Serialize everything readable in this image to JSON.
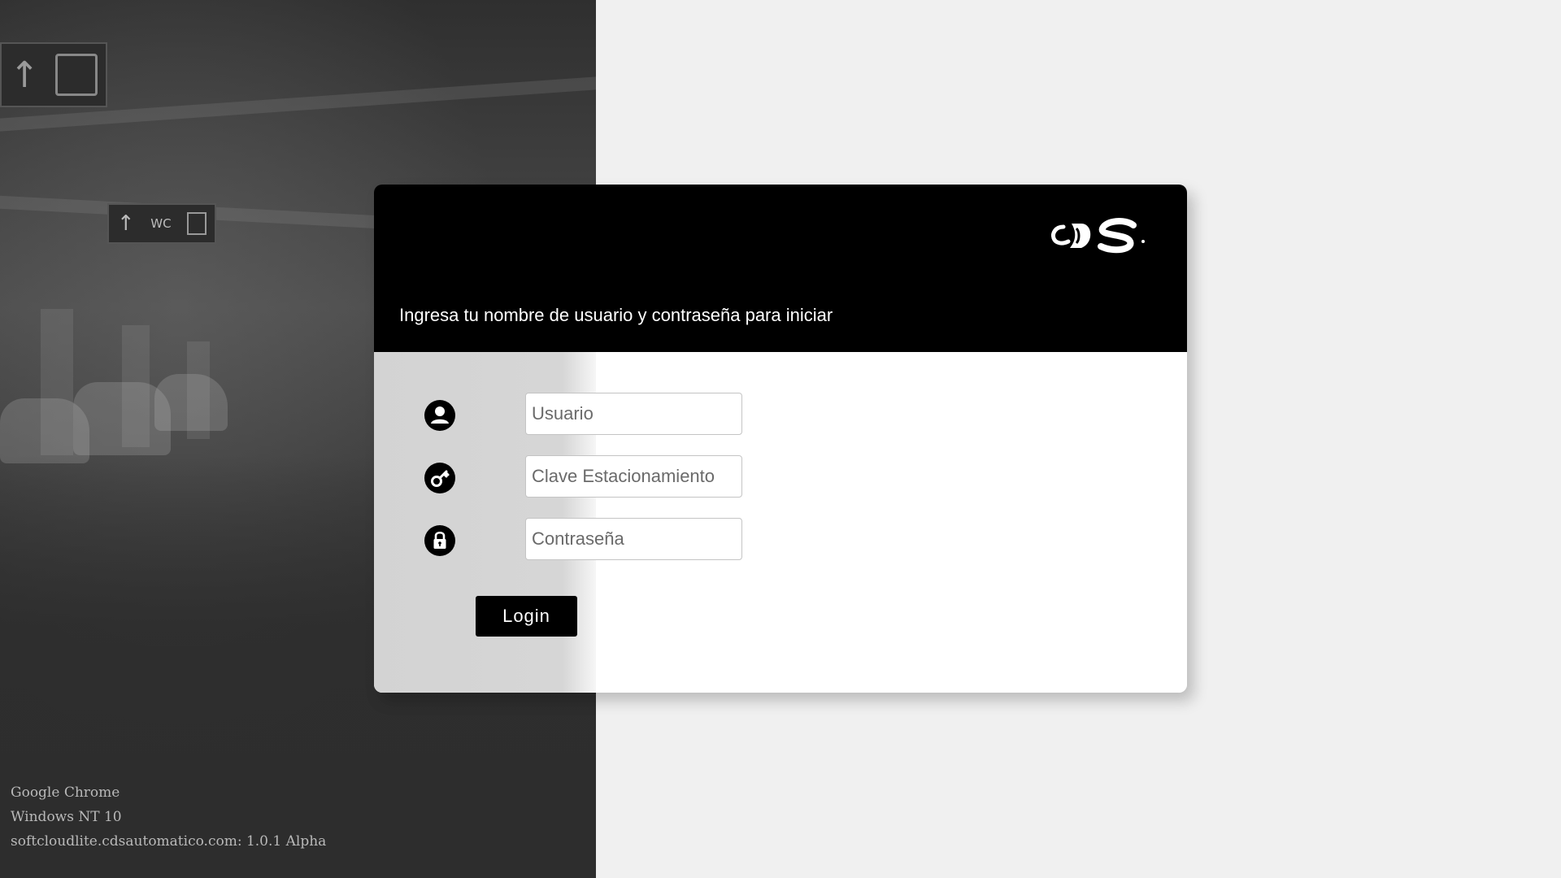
{
  "background": {
    "signs": {
      "top_sign_icons": [
        "arrow-up",
        "luggage-cart"
      ],
      "middle_sign_text": "WC",
      "middle_sign_icons": [
        "arrow-up",
        "wc",
        "elevator"
      ]
    }
  },
  "environment": {
    "browser": "Google Chrome",
    "os": "Windows NT 10",
    "version_line": "softcloudlite.cdsautomatico.com: 1.0.1 Alpha"
  },
  "login": {
    "logo_icon": "cds-logo",
    "subtitle": "Ingresa tu nombre de usuario y contraseña para iniciar",
    "fields": [
      {
        "icon": "user-icon",
        "placeholder": "Usuario",
        "value": ""
      },
      {
        "icon": "key-icon",
        "placeholder": "Clave Estacionamiento",
        "value": ""
      },
      {
        "icon": "lock-icon",
        "placeholder": "Contraseña",
        "value": ""
      }
    ],
    "submit_label": "Login"
  },
  "colors": {
    "header_bg": "#000000",
    "page_bg": "#f0f0f0",
    "button_bg": "#000000",
    "button_text": "#ffffff"
  }
}
